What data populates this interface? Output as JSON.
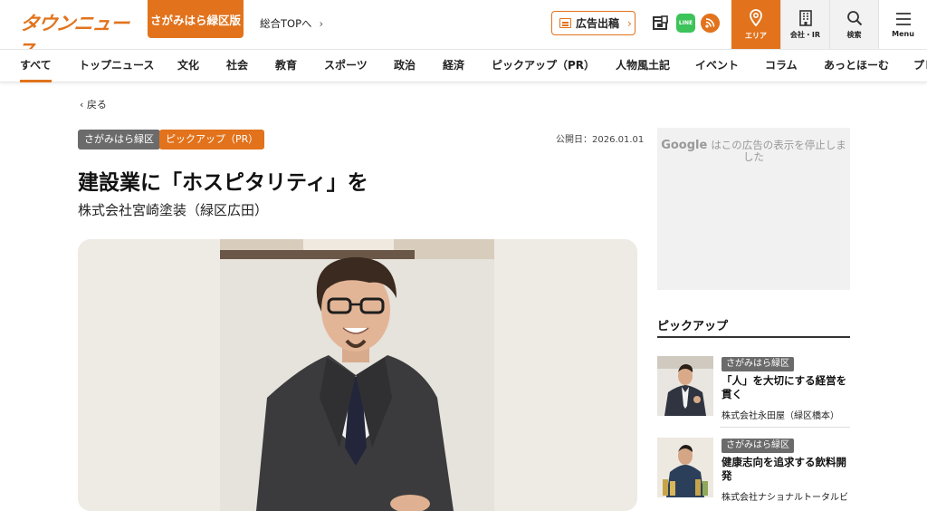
{
  "header": {
    "logo": "タウンニュース",
    "edition": "さがみはら緑区版",
    "top_link": "総合TOPへ",
    "ad_button": "広告出稿",
    "line_label": "LINE",
    "nav": [
      {
        "label": "エリア"
      },
      {
        "label": "会社・IR"
      },
      {
        "label": "検索"
      },
      {
        "label": "Menu"
      }
    ]
  },
  "categories": [
    "すべて",
    "トップニュース",
    "文化",
    "社会",
    "教育",
    "スポーツ",
    "政治",
    "経済",
    "ピックアップ（PR）",
    "人物風土記",
    "イベント",
    "コラム",
    "あっとほーむ",
    "プレ"
  ],
  "article": {
    "back": "戻る",
    "tags": [
      "さがみはら緑区",
      "ピックアップ（PR）"
    ],
    "published_label": "公開日：2026.01.01",
    "title": "建設業に「ホスピタリティ」を",
    "subtitle": "株式会社宮崎塗装（緑区広田）"
  },
  "sidebar": {
    "ad_google": "Google",
    "ad_text": "はこの広告の表示を停止しました",
    "pickup_heading": "ピックアップ",
    "pickup": [
      {
        "tag": "さがみはら緑区",
        "title": "「人」を大切にする経営を貫く",
        "company": "株式会社永田屋（緑区橋本）"
      },
      {
        "tag": "さがみはら緑区",
        "title": "健康志向を追求する飲料開発",
        "company": "株式会社ナショナルトータルビ"
      }
    ]
  },
  "colors": {
    "brand": "#e2731c",
    "tag_gray": "#6b6b6b"
  }
}
